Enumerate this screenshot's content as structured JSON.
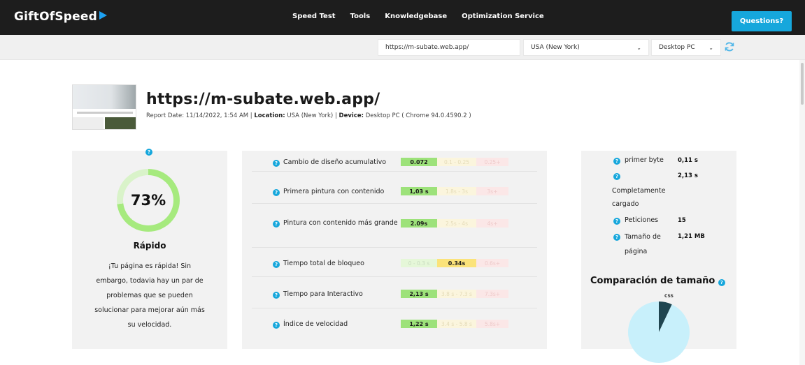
{
  "nav": {
    "logo": "GiftOfSpeed",
    "links": [
      "Speed Test",
      "Tools",
      "Knowledgebase",
      "Optimization Service"
    ],
    "questions_label": "Questions?"
  },
  "toolbar": {
    "url_value": "https://m-subate.web.app/",
    "location_value": "USA (New York)",
    "device_value": "Desktop PC"
  },
  "report": {
    "title": "https://m-subate.web.app/",
    "date_label": "Report Date:",
    "date_value": "11/14/2022, 1:54 AM",
    "location_label": "Location:",
    "location_value": "USA (New York)",
    "device_label": "Device:",
    "device_value": "Desktop PC ( Chrome 94.0.4590.2 )"
  },
  "score": {
    "percent": 73,
    "percent_text": "73%",
    "grade": "Rápido",
    "description": "¡Tu página es rápida! Sin embargo, todavia hay un par de problemas que se pueden solucionar para mejorar aún más su velocidad."
  },
  "metrics": [
    {
      "label": "Cambio de diseño acumulativo",
      "good": "0.072",
      "mid": "0.1 - 0.25",
      "bad": "0.25+",
      "active": "good"
    },
    {
      "label": "Primera pintura con contenido",
      "good": "1,03 s",
      "mid": "1.8s - 3s",
      "bad": "3s+",
      "active": "good"
    },
    {
      "label": "Pintura con contenido más grande",
      "good": "2.09s",
      "mid": "2.5s - 4s",
      "bad": "4s+",
      "active": "good"
    },
    {
      "label": "Tiempo total de bloqueo",
      "good": "0 - 0.3 s",
      "mid": "0.34s",
      "bad": "0.6s+",
      "active": "mid"
    },
    {
      "label": "Tiempo para Interactivo",
      "good": "2,13 s",
      "mid": "3.8 s - 7.3 s",
      "bad": "7.3s+",
      "active": "good"
    },
    {
      "label": "Índice de velocidad",
      "good": "1,22 s",
      "mid": "3.4 s - 5.8 s",
      "bad": "5.8s+",
      "active": "good"
    }
  ],
  "stats": {
    "first_byte_label": "primer byte",
    "first_byte_value": "0,11 s",
    "loaded_label": "Completamente cargado",
    "loaded_value": "2,13 s",
    "requests_label": "Peticiones",
    "requests_value": "15",
    "page_size_label": "Tamaño de página",
    "page_size_value": "1,21 MB"
  },
  "comparison": {
    "title": "Comparación de tamaño",
    "css_label": "CSS",
    "pie": [
      {
        "name": "CSS",
        "value": 7,
        "color": "#1f4550"
      },
      {
        "name": "",
        "value": 93,
        "color": "#c8f0fb"
      }
    ]
  },
  "colors": {
    "accent": "#16a7dc",
    "good": "#9de27a",
    "mid": "#fbe37a"
  }
}
